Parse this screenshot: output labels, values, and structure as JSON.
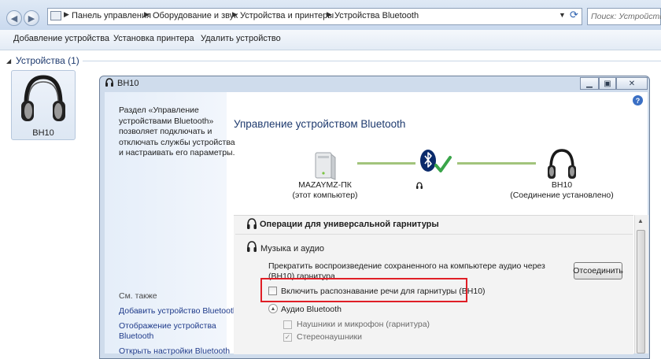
{
  "explorer": {
    "breadcrumbs": [
      "Панель управления",
      "Оборудование и звук",
      "Устройства и принтеры",
      "Устройства Bluetooth"
    ],
    "search_placeholder": "Поиск: Устройства Bl",
    "toolbar": [
      "Добавление устройства",
      "Установка принтера",
      "Удалить устройство"
    ],
    "group_header": "Устройства (1)",
    "device_label": "BH10"
  },
  "dialog": {
    "title": "BH10",
    "left_pane": {
      "description": [
        "Раздел «Управление",
        "устройствами Bluetooth»",
        "позволяет подключать и",
        "отключать службы устройства",
        "и настраивать его параметры."
      ],
      "see_also": "См. также",
      "links": [
        "Добавить устройство Bluetooth",
        "Отображение устройства",
        "Bluetooth",
        "Открыть настройки Bluetooth"
      ]
    },
    "heading": "Управление устройством Bluetooth",
    "computer": {
      "name": "MAZAYMZ-ПК",
      "sub": "(этот компьютер)"
    },
    "headset": {
      "name": "BH10",
      "sub": "(Соединение установлено)"
    },
    "section_headset_ops": "Операции для универсальной гарнитуры",
    "section_music": "Музыка и аудио",
    "music_desc": [
      "Прекратить воспроизведение сохраненного на компьютере аудио через",
      "(BH10) гарнитура"
    ],
    "disconnect_label": "Отсоединить",
    "speech_checkbox_label": "Включить распознавание речи для гарнитуры (BH10)",
    "audio_bluetooth_label": "Аудио Bluetooth",
    "headset_mic_label": "Наушники и микрофон (гарнитура)",
    "stereo_label": "Стереонаушники",
    "speech_checked": false,
    "headset_mic_checked": false,
    "stereo_checked": true
  },
  "colors": {
    "highlight": "#e01e26",
    "link": "#1e3a8a",
    "connection_line": "#a2c47c",
    "check_green": "#3aa54a"
  }
}
